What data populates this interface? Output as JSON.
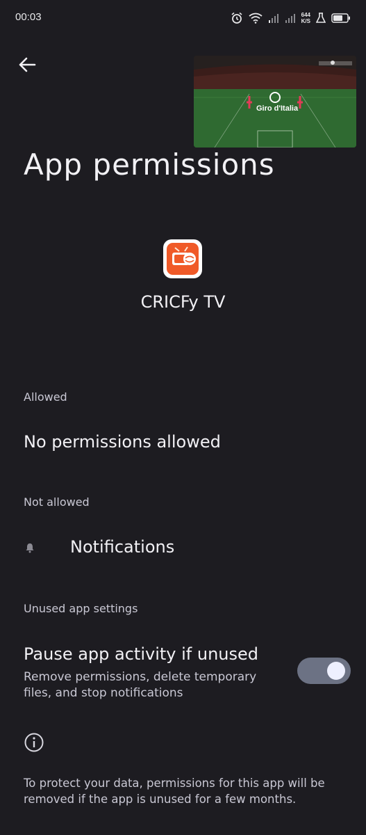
{
  "status_bar": {
    "time": "00:03",
    "net_speed_value": "644",
    "net_speed_unit": "K/S"
  },
  "pip": {
    "overlay_text": "Giro d'Italia"
  },
  "header": {
    "title": "App permissions"
  },
  "app": {
    "name": "CRICFy TV"
  },
  "sections": {
    "allowed_label": "Allowed",
    "allowed_empty": "No permissions allowed",
    "not_allowed_label": "Not allowed",
    "notifications_label": "Notifications",
    "unused_label": "Unused app settings"
  },
  "pause_setting": {
    "title": "Pause app activity if unused",
    "description": "Remove permissions, delete temporary files, and stop notifications",
    "enabled": true
  },
  "footer": {
    "text": "To protect your data, permissions for this app will be removed if the app is unused for a few months."
  },
  "colors": {
    "background": "#1d1c21",
    "toggle_track": "#6c7284",
    "toggle_knob": "#eef0ff",
    "app_icon_accent": "#f05a28"
  },
  "icons": [
    "alarm-icon",
    "wifi-icon",
    "signal-icon",
    "flask-icon",
    "battery-icon",
    "back-arrow-icon",
    "bell-icon",
    "info-icon"
  ]
}
